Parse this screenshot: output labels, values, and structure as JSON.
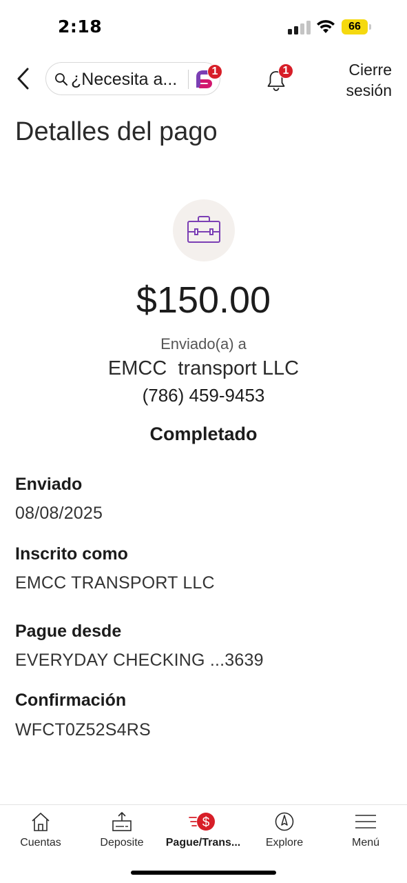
{
  "status_bar": {
    "time": "2:18",
    "battery": "66"
  },
  "header": {
    "search_text": "¿Necesita a...",
    "assistant_badge": "1",
    "notifications_badge": "1",
    "signout_line1": "Cierre",
    "signout_line2": "sesión"
  },
  "page": {
    "title": "Detalles del pago"
  },
  "payment": {
    "amount": "$150.00",
    "sent_to_label": "Enviado(a) a",
    "payee": "EMCC  transport LLC",
    "phone": "(786) 459-9453",
    "status": "Completado"
  },
  "details": [
    {
      "label": "Enviado",
      "value": "08/08/2025"
    },
    {
      "label": "Inscrito como",
      "value": "EMCC TRANSPORT LLC"
    },
    {
      "label": "Pague desde",
      "value": "EVERYDAY CHECKING ...3639"
    },
    {
      "label": "Confirmación",
      "value": "WFCT0Z52S4RS"
    }
  ],
  "bottom_nav": [
    {
      "label": "Cuentas",
      "icon": "home-icon"
    },
    {
      "label": "Deposite",
      "icon": "deposit-icon"
    },
    {
      "label": "Pague/Trans...",
      "icon": "pay-transfer-icon",
      "active": true
    },
    {
      "label": "Explore",
      "icon": "compass-icon"
    },
    {
      "label": "Menú",
      "icon": "hamburger-icon"
    }
  ],
  "colors": {
    "accent_red": "#d71e28",
    "purple_icon": "#7b3fb4",
    "battery_yellow": "#f5d90f",
    "hero_circle_bg": "#f4f0ed"
  }
}
